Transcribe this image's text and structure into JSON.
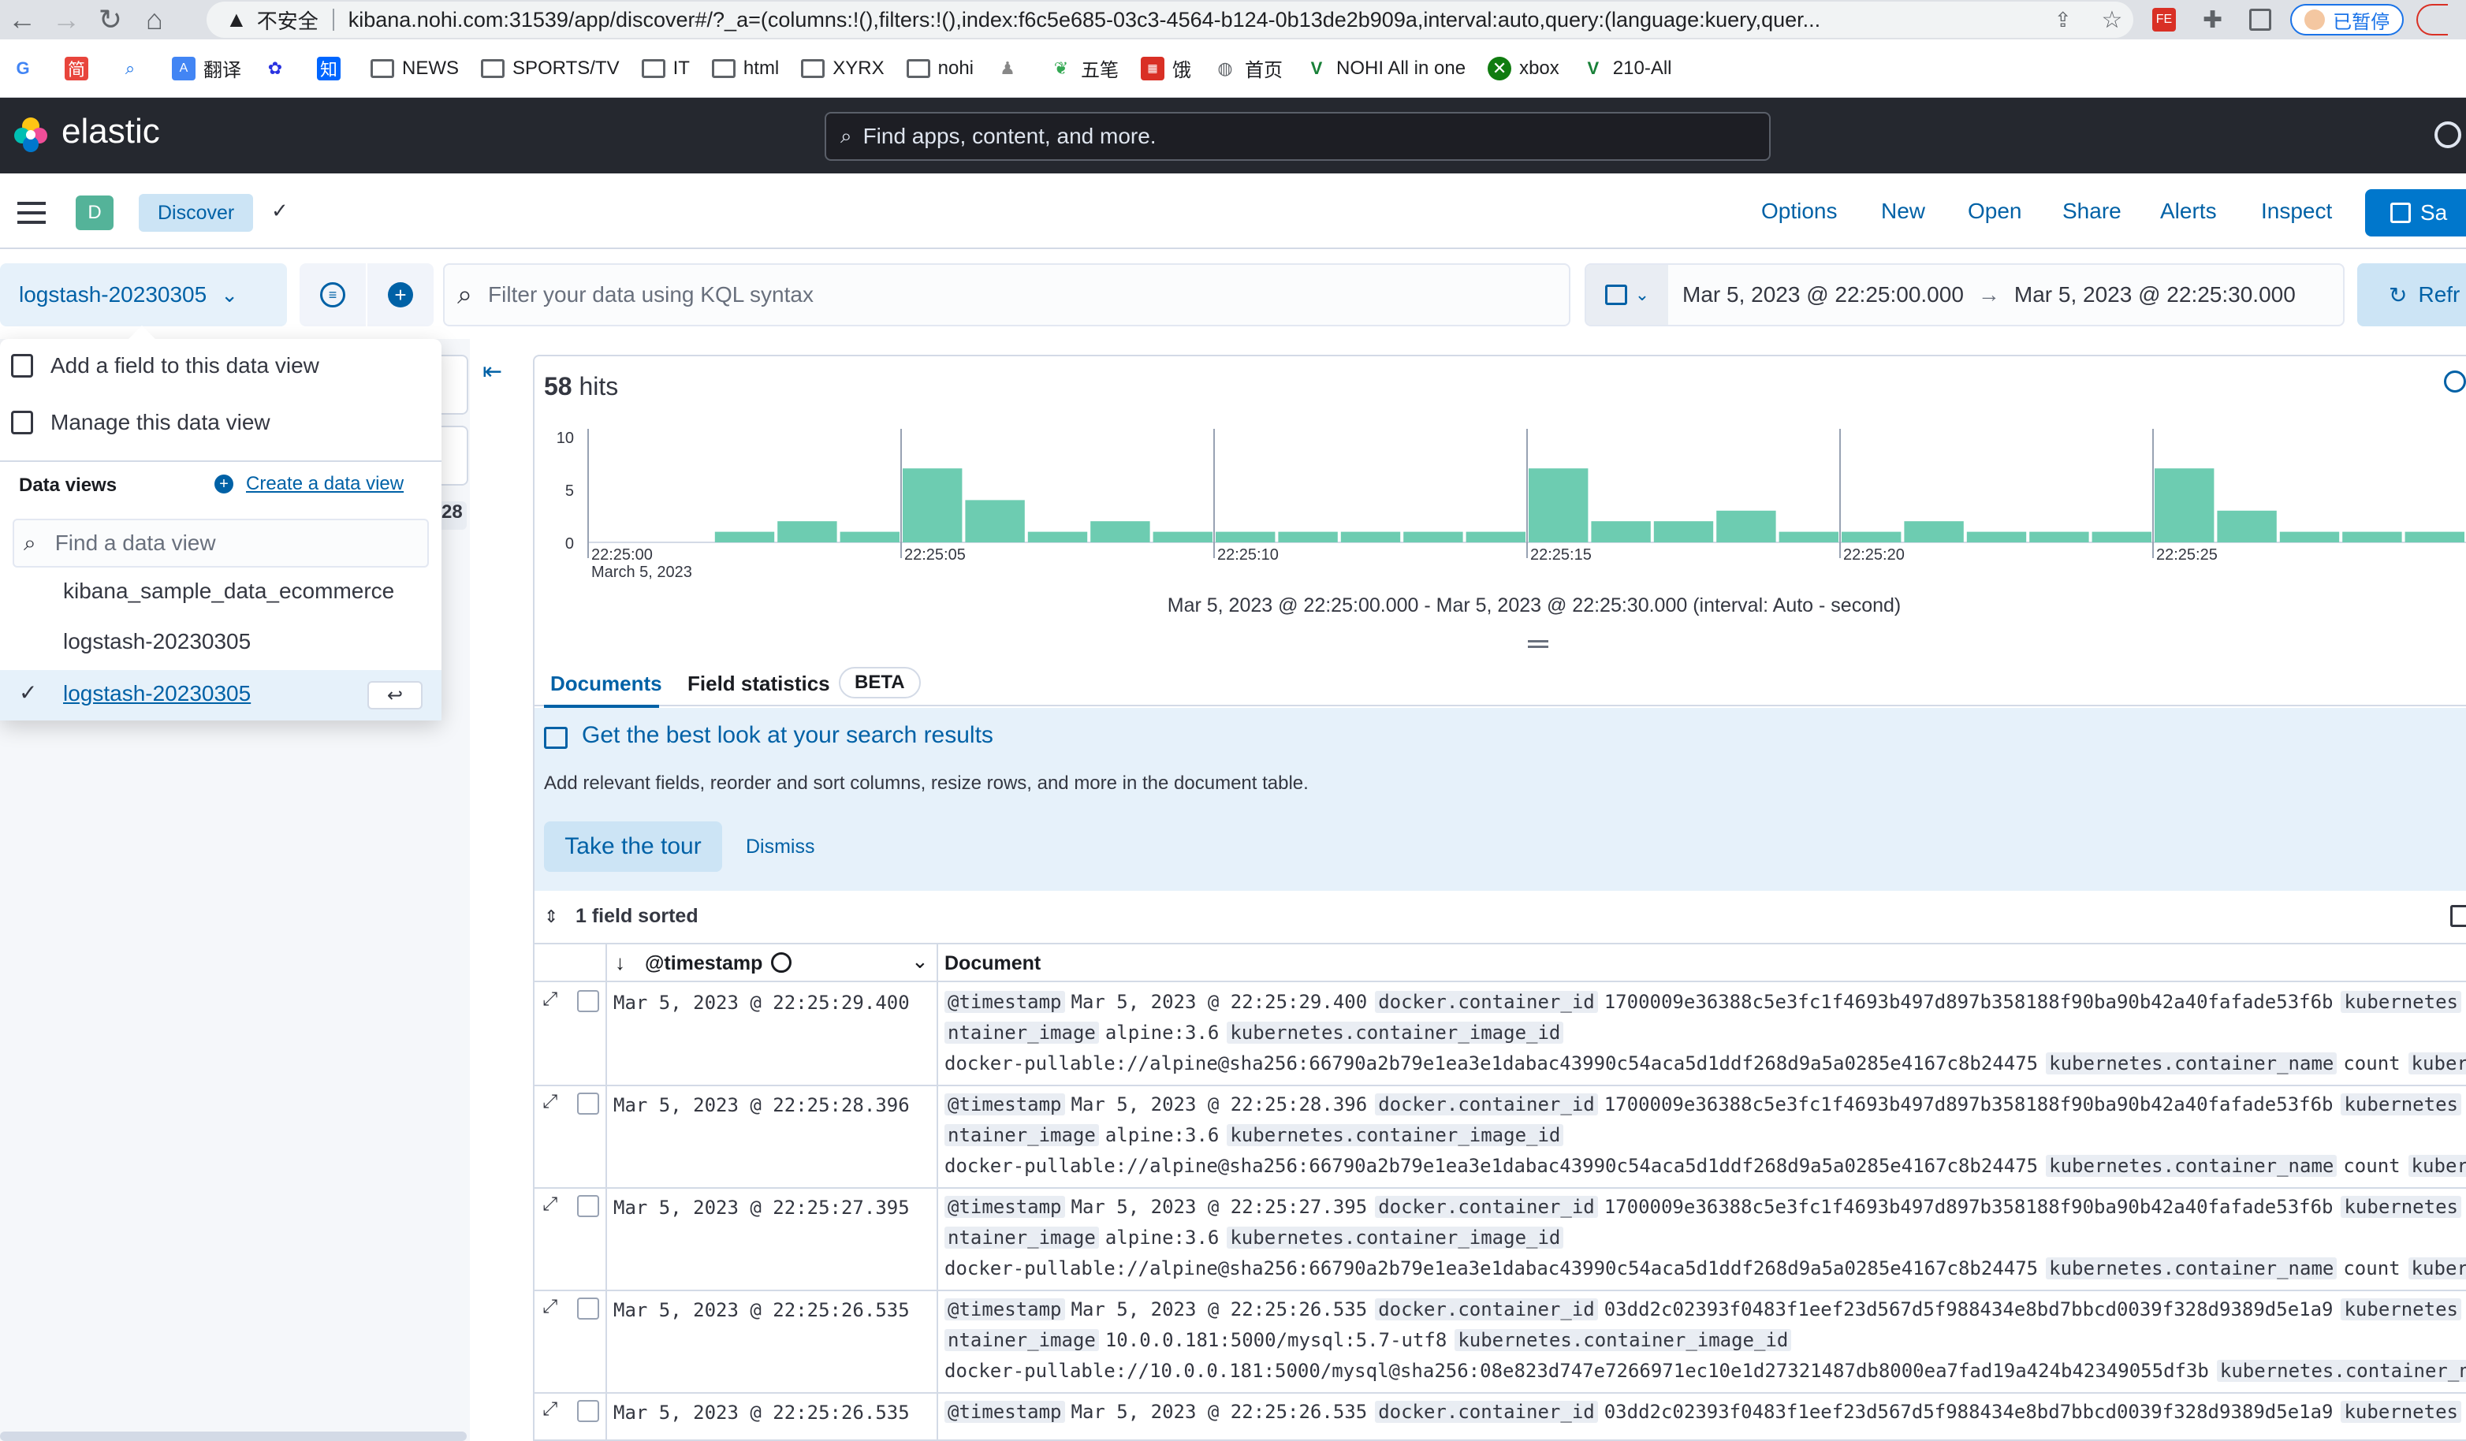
{
  "browser": {
    "security_label": "不安全",
    "url": "kibana.nohi.com:31539/app/discover#/?_a=(columns:!(),filters:!(),index:f6c5e685-03c3-4564-b124-0b13de2b909a,interval:auto,query:(language:kuery,quer...",
    "profile_label": "已暂停",
    "bookmarks": [
      "简",
      "翻译",
      "知",
      "NEWS",
      "SPORTS/TV",
      "IT",
      "html",
      "XYRX",
      "nohi",
      "五笔",
      "饿",
      "首页",
      "NOHI All in one",
      "xbox",
      "210-All"
    ]
  },
  "kibana": {
    "logo_text": "elastic",
    "search_placeholder": "Find apps, content, and more.",
    "space_initial": "D",
    "breadcrumb": "Discover",
    "menu": [
      "Options",
      "New",
      "Open",
      "Share",
      "Alerts",
      "Inspect"
    ],
    "save_label": "Sa",
    "refresh_label": "Refr"
  },
  "query_bar": {
    "data_view": "logstash-20230305",
    "kql_placeholder": "Filter your data using KQL syntax",
    "date_start": "Mar 5, 2023 @ 22:25:00.000",
    "date_end": "Mar 5, 2023 @ 22:25:30.000"
  },
  "popover": {
    "add_field": "Add a field to this data view",
    "manage": "Manage this data view",
    "section_title": "Data views",
    "create_link": "Create a data view",
    "find_placeholder": "Find a data view",
    "options": [
      "kibana_sample_data_ecommerce",
      "logstash-20230305",
      "logstash-20230305"
    ],
    "behind_count": "28"
  },
  "main": {
    "hits_count": "58",
    "hits_label": "hits",
    "interval_text": "Mar 5, 2023 @ 22:25:00.000 - Mar 5, 2023 @ 22:25:30.000 (interval: Auto - second)",
    "tabs": [
      "Documents",
      "Field statistics"
    ],
    "beta_badge": "BETA",
    "tour_title": "Get the best look at your search results",
    "tour_desc": "Add relevant fields, reorder and sort columns, resize rows, and more in the document table.",
    "tour_button": "Take the tour",
    "dismiss": "Dismiss",
    "sorted_label": "1 field sorted",
    "col_timestamp": "@timestamp",
    "col_document": "Document"
  },
  "rows": [
    {
      "ts": "Mar 5, 2023 @ 22:25:29.400",
      "l1": [
        [
          "@timestamp",
          "Mar 5, 2023 @ 22:25:29.400"
        ],
        [
          "docker.container_id",
          "1700009e36388c5e3fc1f4693b497d897b358188f90ba90b42a40fafade53f6b"
        ],
        [
          "kubernetes",
          ""
        ]
      ],
      "l2": [
        [
          "ntainer_image",
          "alpine:3.6"
        ],
        [
          "kubernetes.container_image_id",
          ""
        ]
      ],
      "l3": [
        [
          "",
          "docker-pullable://alpine@sha256:66790a2b79e1ea3e1dabac43990c54aca5d1ddf268d9a5a0285e4167c8b24475"
        ],
        [
          "kubernetes.container_name",
          "count"
        ],
        [
          "kuber",
          ""
        ]
      ]
    },
    {
      "ts": "Mar 5, 2023 @ 22:25:28.396",
      "l1": [
        [
          "@timestamp",
          "Mar 5, 2023 @ 22:25:28.396"
        ],
        [
          "docker.container_id",
          "1700009e36388c5e3fc1f4693b497d897b358188f90ba90b42a40fafade53f6b"
        ],
        [
          "kubernetes",
          ""
        ]
      ],
      "l2": [
        [
          "ntainer_image",
          "alpine:3.6"
        ],
        [
          "kubernetes.container_image_id",
          ""
        ]
      ],
      "l3": [
        [
          "",
          "docker-pullable://alpine@sha256:66790a2b79e1ea3e1dabac43990c54aca5d1ddf268d9a5a0285e4167c8b24475"
        ],
        [
          "kubernetes.container_name",
          "count"
        ],
        [
          "kuber",
          ""
        ]
      ]
    },
    {
      "ts": "Mar 5, 2023 @ 22:25:27.395",
      "l1": [
        [
          "@timestamp",
          "Mar 5, 2023 @ 22:25:27.395"
        ],
        [
          "docker.container_id",
          "1700009e36388c5e3fc1f4693b497d897b358188f90ba90b42a40fafade53f6b"
        ],
        [
          "kubernetes",
          ""
        ]
      ],
      "l2": [
        [
          "ntainer_image",
          "alpine:3.6"
        ],
        [
          "kubernetes.container_image_id",
          ""
        ]
      ],
      "l3": [
        [
          "",
          "docker-pullable://alpine@sha256:66790a2b79e1ea3e1dabac43990c54aca5d1ddf268d9a5a0285e4167c8b24475"
        ],
        [
          "kubernetes.container_name",
          "count"
        ],
        [
          "kuber",
          ""
        ]
      ]
    },
    {
      "ts": "Mar 5, 2023 @ 22:25:26.535",
      "l1": [
        [
          "@timestamp",
          "Mar 5, 2023 @ 22:25:26.535"
        ],
        [
          "docker.container_id",
          "03dd2c02393f0483f1eef23d567d5f988434e8bd7bbcd0039f328d9389d5e1a9"
        ],
        [
          "kubernetes",
          ""
        ]
      ],
      "l2": [
        [
          "ntainer_image",
          "10.0.0.181:5000/mysql:5.7-utf8"
        ],
        [
          "kubernetes.container_image_id",
          ""
        ]
      ],
      "l3": [
        [
          "",
          "docker-pullable://10.0.0.181:5000/mysql@sha256:08e823d747e7266971ec10e1d27321487db8000ea7fad19a424b42349055df3b"
        ],
        [
          "kubernetes.container_n",
          ""
        ]
      ]
    },
    {
      "ts": "Mar 5, 2023 @ 22:25:26.535",
      "l1": [
        [
          "@timestamp",
          "Mar 5, 2023 @ 22:25:26.535"
        ],
        [
          "docker.container_id",
          "03dd2c02393f0483f1eef23d567d5f988434e8bd7bbcd0039f328d9389d5e1a9"
        ],
        [
          "kubernetes",
          ""
        ]
      ],
      "l2": [],
      "l3": []
    }
  ],
  "chart_data": {
    "type": "bar",
    "ylim": [
      0,
      10
    ],
    "yticks": [
      0,
      5,
      10
    ],
    "xtick_labels": [
      "22:25:00",
      "22:25:05",
      "22:25:10",
      "22:25:15",
      "22:25:20",
      "22:25:25"
    ],
    "xtick_sublabel": "March 5, 2023",
    "categories": [
      "22:25:00",
      "22:25:01",
      "22:25:02",
      "22:25:03",
      "22:25:04",
      "22:25:05",
      "22:25:06",
      "22:25:07",
      "22:25:08",
      "22:25:09",
      "22:25:10",
      "22:25:11",
      "22:25:12",
      "22:25:13",
      "22:25:14",
      "22:25:15",
      "22:25:16",
      "22:25:17",
      "22:25:18",
      "22:25:19",
      "22:25:20",
      "22:25:21",
      "22:25:22",
      "22:25:23",
      "22:25:24",
      "22:25:25",
      "22:25:26",
      "22:25:27",
      "22:25:28",
      "22:25:29"
    ],
    "values": [
      0,
      0,
      1,
      2,
      1,
      7,
      4,
      1,
      2,
      1,
      1,
      1,
      1,
      1,
      1,
      7,
      2,
      2,
      3,
      1,
      1,
      2,
      1,
      1,
      1,
      7,
      3,
      1,
      1,
      1
    ],
    "bar_color": "#6dccb1"
  }
}
